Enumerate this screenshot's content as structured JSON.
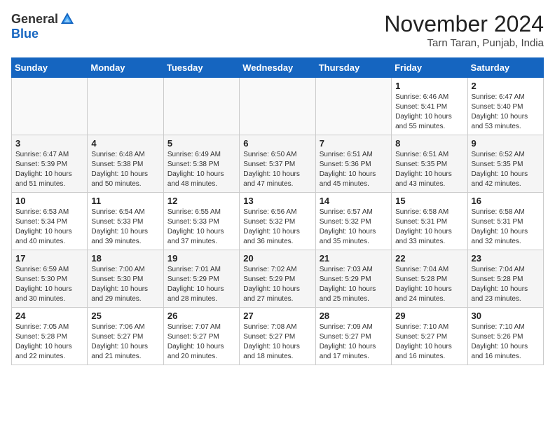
{
  "header": {
    "logo_general": "General",
    "logo_blue": "Blue",
    "month_title": "November 2024",
    "location": "Tarn Taran, Punjab, India"
  },
  "weekdays": [
    "Sunday",
    "Monday",
    "Tuesday",
    "Wednesday",
    "Thursday",
    "Friday",
    "Saturday"
  ],
  "weeks": [
    [
      {
        "day": "",
        "info": ""
      },
      {
        "day": "",
        "info": ""
      },
      {
        "day": "",
        "info": ""
      },
      {
        "day": "",
        "info": ""
      },
      {
        "day": "",
        "info": ""
      },
      {
        "day": "1",
        "info": "Sunrise: 6:46 AM\nSunset: 5:41 PM\nDaylight: 10 hours\nand 55 minutes."
      },
      {
        "day": "2",
        "info": "Sunrise: 6:47 AM\nSunset: 5:40 PM\nDaylight: 10 hours\nand 53 minutes."
      }
    ],
    [
      {
        "day": "3",
        "info": "Sunrise: 6:47 AM\nSunset: 5:39 PM\nDaylight: 10 hours\nand 51 minutes."
      },
      {
        "day": "4",
        "info": "Sunrise: 6:48 AM\nSunset: 5:38 PM\nDaylight: 10 hours\nand 50 minutes."
      },
      {
        "day": "5",
        "info": "Sunrise: 6:49 AM\nSunset: 5:38 PM\nDaylight: 10 hours\nand 48 minutes."
      },
      {
        "day": "6",
        "info": "Sunrise: 6:50 AM\nSunset: 5:37 PM\nDaylight: 10 hours\nand 47 minutes."
      },
      {
        "day": "7",
        "info": "Sunrise: 6:51 AM\nSunset: 5:36 PM\nDaylight: 10 hours\nand 45 minutes."
      },
      {
        "day": "8",
        "info": "Sunrise: 6:51 AM\nSunset: 5:35 PM\nDaylight: 10 hours\nand 43 minutes."
      },
      {
        "day": "9",
        "info": "Sunrise: 6:52 AM\nSunset: 5:35 PM\nDaylight: 10 hours\nand 42 minutes."
      }
    ],
    [
      {
        "day": "10",
        "info": "Sunrise: 6:53 AM\nSunset: 5:34 PM\nDaylight: 10 hours\nand 40 minutes."
      },
      {
        "day": "11",
        "info": "Sunrise: 6:54 AM\nSunset: 5:33 PM\nDaylight: 10 hours\nand 39 minutes."
      },
      {
        "day": "12",
        "info": "Sunrise: 6:55 AM\nSunset: 5:33 PM\nDaylight: 10 hours\nand 37 minutes."
      },
      {
        "day": "13",
        "info": "Sunrise: 6:56 AM\nSunset: 5:32 PM\nDaylight: 10 hours\nand 36 minutes."
      },
      {
        "day": "14",
        "info": "Sunrise: 6:57 AM\nSunset: 5:32 PM\nDaylight: 10 hours\nand 35 minutes."
      },
      {
        "day": "15",
        "info": "Sunrise: 6:58 AM\nSunset: 5:31 PM\nDaylight: 10 hours\nand 33 minutes."
      },
      {
        "day": "16",
        "info": "Sunrise: 6:58 AM\nSunset: 5:31 PM\nDaylight: 10 hours\nand 32 minutes."
      }
    ],
    [
      {
        "day": "17",
        "info": "Sunrise: 6:59 AM\nSunset: 5:30 PM\nDaylight: 10 hours\nand 30 minutes."
      },
      {
        "day": "18",
        "info": "Sunrise: 7:00 AM\nSunset: 5:30 PM\nDaylight: 10 hours\nand 29 minutes."
      },
      {
        "day": "19",
        "info": "Sunrise: 7:01 AM\nSunset: 5:29 PM\nDaylight: 10 hours\nand 28 minutes."
      },
      {
        "day": "20",
        "info": "Sunrise: 7:02 AM\nSunset: 5:29 PM\nDaylight: 10 hours\nand 27 minutes."
      },
      {
        "day": "21",
        "info": "Sunrise: 7:03 AM\nSunset: 5:29 PM\nDaylight: 10 hours\nand 25 minutes."
      },
      {
        "day": "22",
        "info": "Sunrise: 7:04 AM\nSunset: 5:28 PM\nDaylight: 10 hours\nand 24 minutes."
      },
      {
        "day": "23",
        "info": "Sunrise: 7:04 AM\nSunset: 5:28 PM\nDaylight: 10 hours\nand 23 minutes."
      }
    ],
    [
      {
        "day": "24",
        "info": "Sunrise: 7:05 AM\nSunset: 5:28 PM\nDaylight: 10 hours\nand 22 minutes."
      },
      {
        "day": "25",
        "info": "Sunrise: 7:06 AM\nSunset: 5:27 PM\nDaylight: 10 hours\nand 21 minutes."
      },
      {
        "day": "26",
        "info": "Sunrise: 7:07 AM\nSunset: 5:27 PM\nDaylight: 10 hours\nand 20 minutes."
      },
      {
        "day": "27",
        "info": "Sunrise: 7:08 AM\nSunset: 5:27 PM\nDaylight: 10 hours\nand 18 minutes."
      },
      {
        "day": "28",
        "info": "Sunrise: 7:09 AM\nSunset: 5:27 PM\nDaylight: 10 hours\nand 17 minutes."
      },
      {
        "day": "29",
        "info": "Sunrise: 7:10 AM\nSunset: 5:27 PM\nDaylight: 10 hours\nand 16 minutes."
      },
      {
        "day": "30",
        "info": "Sunrise: 7:10 AM\nSunset: 5:26 PM\nDaylight: 10 hours\nand 16 minutes."
      }
    ]
  ]
}
